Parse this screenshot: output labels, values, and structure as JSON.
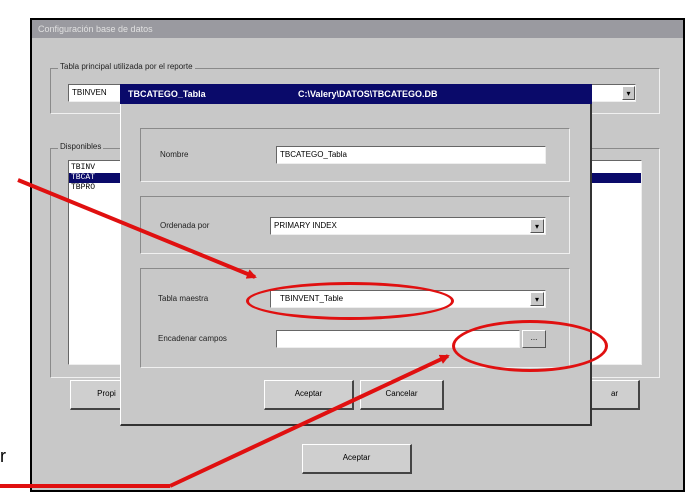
{
  "main_window": {
    "title": "Configuración base de datos",
    "main_table_group_label": "Tabla principal utilizada por el reporte",
    "main_table_value": "TBINVEN",
    "available_group_label": "Disponibles",
    "available_items": [
      "TBINV",
      "TBCAT",
      "TBPRO"
    ],
    "selected_item_index": 1,
    "properties_button_label": "Propi",
    "right_button_label": "ar",
    "accept_button_label": "Aceptar",
    "dropdown_arrow": "▾"
  },
  "dialog": {
    "title_name": "TBCATEGO_Tabla",
    "title_path": "C:\\Valery\\DATOS\\TBCATEGO.DB",
    "name_label": "Nombre",
    "name_value": "TBCATEGO_Tabla",
    "order_label": "Ordenada por",
    "order_value": "PRIMARY INDEX",
    "master_label": "Tabla maestra",
    "master_value": "TBINVENT_Table",
    "link_fields_label": "Encadenar campos",
    "link_fields_value": "",
    "ellipsis_button_label": "...",
    "accept_button_label": "Aceptar",
    "cancel_button_label": "Cancelar"
  },
  "stray_text": "r",
  "annotation_color": "#e01010"
}
